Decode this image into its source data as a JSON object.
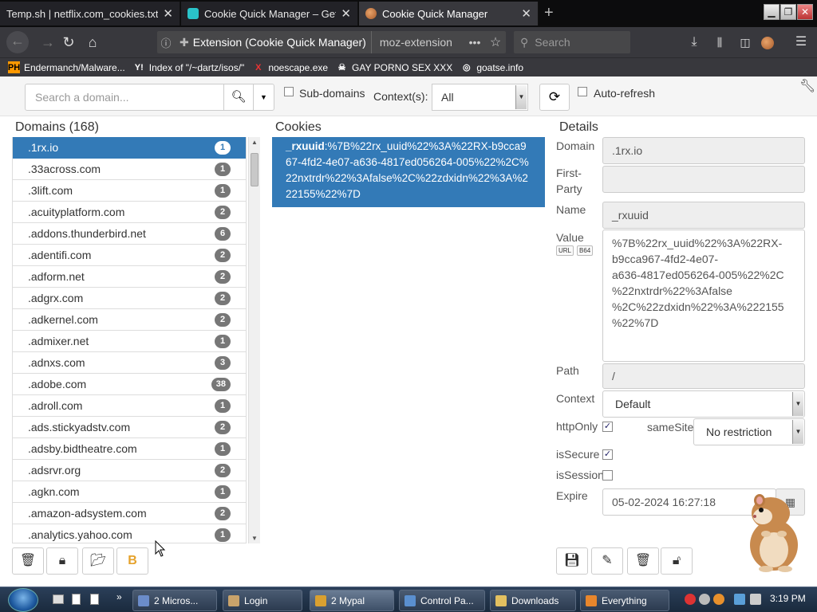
{
  "browser": {
    "tabs": [
      {
        "title": "Temp.sh | netflix.com_cookies.txt",
        "active": false
      },
      {
        "title": "Cookie Quick Manager – Get this",
        "active": false
      },
      {
        "title": "Cookie Quick Manager",
        "active": true
      }
    ],
    "url_label": "Extension (Cookie Quick Manager)",
    "url": "moz-extension",
    "search_placeholder": "Search",
    "bookmarks": [
      {
        "badge": "PH",
        "label": "Endermanch/Malware..."
      },
      {
        "badge": "Y!",
        "label": "Index of \"/~dartz/isos/\""
      },
      {
        "badge": "X",
        "label": "noescape.exe"
      },
      {
        "badge": "☠",
        "label": "GAY PORNO SEX XXX"
      },
      {
        "badge": "◎",
        "label": "goatse.info"
      }
    ]
  },
  "toolbar": {
    "search_placeholder": "Search a domain...",
    "subdomains_label": "Sub-domains",
    "contexts_label": "Context(s):",
    "context_value": "All",
    "autorefresh_label": "Auto-refresh"
  },
  "domains": {
    "heading": "Domains (168)",
    "items": [
      {
        "name": ".1rx.io",
        "count": "1"
      },
      {
        "name": ".33across.com",
        "count": "1"
      },
      {
        "name": ".3lift.com",
        "count": "1"
      },
      {
        "name": ".acuityplatform.com",
        "count": "2"
      },
      {
        "name": ".addons.thunderbird.net",
        "count": "6"
      },
      {
        "name": ".adentifi.com",
        "count": "2"
      },
      {
        "name": ".adform.net",
        "count": "2"
      },
      {
        "name": ".adgrx.com",
        "count": "2"
      },
      {
        "name": ".adkernel.com",
        "count": "2"
      },
      {
        "name": ".admixer.net",
        "count": "1"
      },
      {
        "name": ".adnxs.com",
        "count": "3"
      },
      {
        "name": ".adobe.com",
        "count": "38"
      },
      {
        "name": ".adroll.com",
        "count": "1"
      },
      {
        "name": ".ads.stickyadstv.com",
        "count": "2"
      },
      {
        "name": ".adsby.bidtheatre.com",
        "count": "1"
      },
      {
        "name": ".adsrvr.org",
        "count": "2"
      },
      {
        "name": ".agkn.com",
        "count": "1"
      },
      {
        "name": ".amazon-adsystem.com",
        "count": "2"
      },
      {
        "name": ".analytics.yahoo.com",
        "count": "1"
      }
    ]
  },
  "cookies": {
    "heading": "Cookies",
    "items": [
      {
        "name": "_rxuuid",
        "value": "%7B%22rx_uuid%22%3A%22RX-b9cca967-4fd2-4e07-a636-4817ed056264-005%22%2C%22nxtrdr%22%3Afalse%2C%22zdxidn%22%3A%222155%22%7D"
      }
    ]
  },
  "details": {
    "heading": "Details",
    "domain_label": "Domain",
    "domain_value": ".1rx.io",
    "firstparty_label_1": "First-",
    "firstparty_label_2": "Party",
    "firstparty_value": "",
    "name_label": "Name",
    "name_value": "_rxuuid",
    "value_label": "Value",
    "url_badge": "URL",
    "b64_badge": "B64",
    "value_lines": [
      "%7B%22rx_uuid%22%3A%22RX-",
      "b9cca967-4fd2-4e07-",
      "a636-4817ed056264-005%22%2C",
      "%22nxtrdr%22%3Afalse",
      "%2C%22zdxidn%22%3A%222155",
      "%22%7D"
    ],
    "path_label": "Path",
    "path_value": "/",
    "context_label": "Context",
    "context_value": "Default",
    "httponly_label": "httpOnly",
    "httponly_checked": true,
    "samesite_label": "sameSite",
    "samesite_value": "No restriction",
    "issecure_label": "isSecure",
    "issecure_checked": true,
    "issession_label": "isSession",
    "issession_checked": false,
    "expire_label": "Expire",
    "expire_value": "05-02-2024 16:27:18"
  },
  "taskbar": {
    "items": [
      {
        "label": "2 Micros...",
        "icon_color": "#6b8cc9"
      },
      {
        "label": "Login",
        "icon_color": "#c9a36b"
      },
      {
        "label": "2 Mypal",
        "icon_color": "#d9a030"
      },
      {
        "label": "Control Pa...",
        "icon_color": "#5a8fcf"
      },
      {
        "label": "Downloads",
        "icon_color": "#e3c060"
      },
      {
        "label": "Everything",
        "icon_color": "#e8862c"
      }
    ],
    "clock": "3:19 PM"
  }
}
